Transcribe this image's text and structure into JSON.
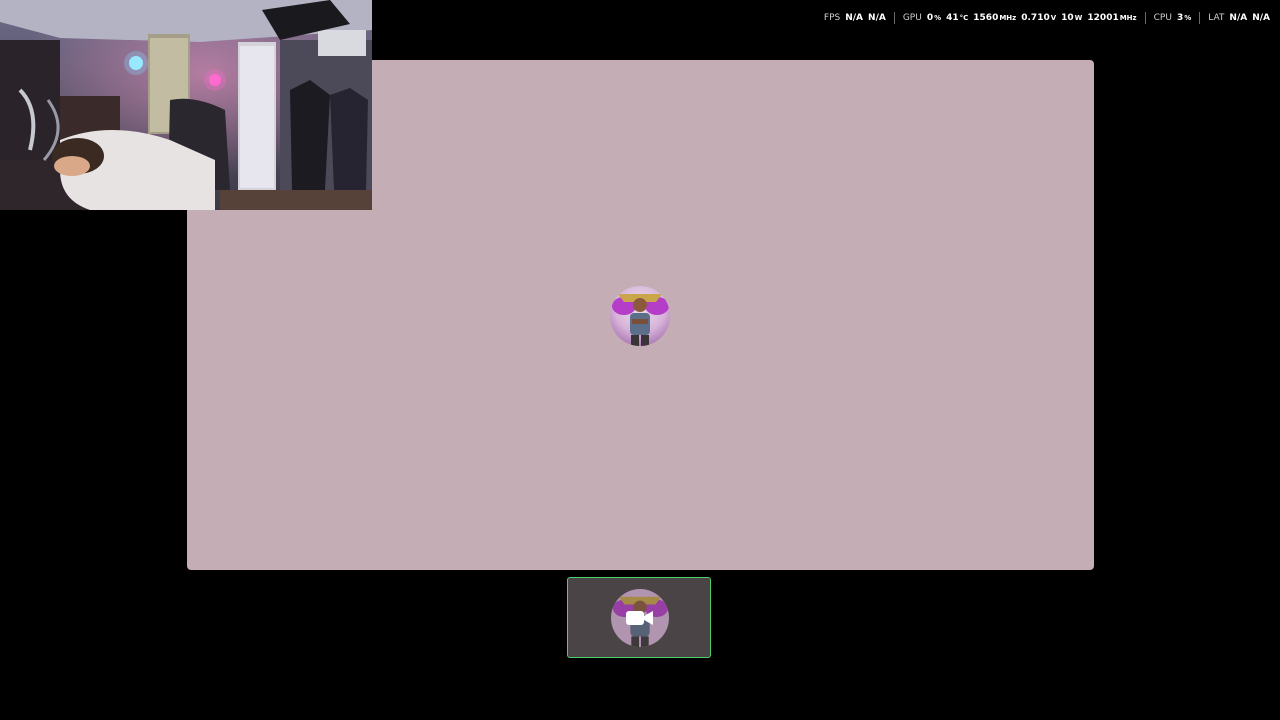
{
  "perf_overlay": {
    "fps": {
      "label": "FPS",
      "value1": "N/A",
      "value2": "N/A"
    },
    "gpu": {
      "label": "GPU",
      "usage": "0",
      "usage_unit": "%",
      "temp": "41",
      "temp_unit": "°C",
      "clock": "1560",
      "clock_unit": "MHz",
      "voltage": "0.710",
      "voltage_unit": "V",
      "power": "10",
      "power_unit": "W",
      "mem_clock": "12001",
      "mem_clock_unit": "MHz"
    },
    "cpu": {
      "label": "CPU",
      "usage": "3",
      "usage_unit": "%"
    },
    "lat": {
      "label": "LAT",
      "value1": "N/A",
      "value2": "N/A"
    }
  },
  "main_tile": {
    "background": "#c4adb4",
    "avatar": "user-avatar-photo"
  },
  "webcam": {
    "content": "webcam-feed"
  },
  "thumbnail": {
    "border_color": "#4fce6b",
    "icon": "video-camera-icon",
    "avatar": "user-avatar-photo"
  }
}
